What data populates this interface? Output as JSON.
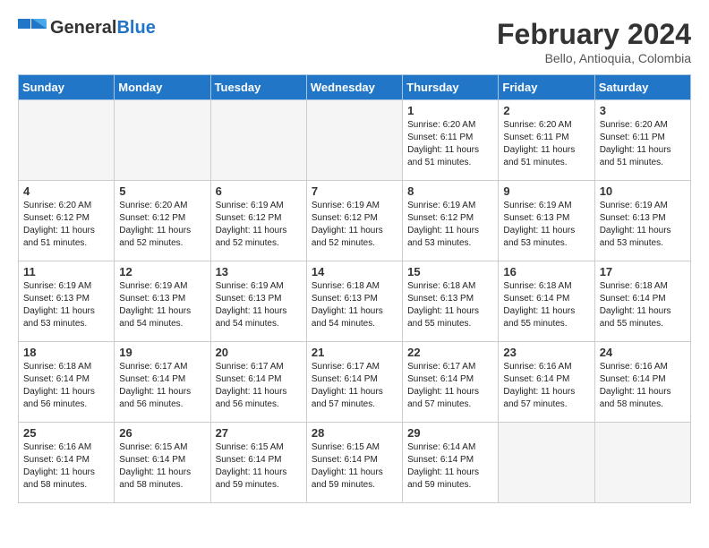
{
  "header": {
    "logo_general": "General",
    "logo_blue": "Blue",
    "month_title": "February 2024",
    "location": "Bello, Antioquia, Colombia"
  },
  "days_of_week": [
    "Sunday",
    "Monday",
    "Tuesday",
    "Wednesday",
    "Thursday",
    "Friday",
    "Saturday"
  ],
  "weeks": [
    [
      {
        "day": "",
        "info": ""
      },
      {
        "day": "",
        "info": ""
      },
      {
        "day": "",
        "info": ""
      },
      {
        "day": "",
        "info": ""
      },
      {
        "day": "1",
        "info": "Sunrise: 6:20 AM\nSunset: 6:11 PM\nDaylight: 11 hours\nand 51 minutes."
      },
      {
        "day": "2",
        "info": "Sunrise: 6:20 AM\nSunset: 6:11 PM\nDaylight: 11 hours\nand 51 minutes."
      },
      {
        "day": "3",
        "info": "Sunrise: 6:20 AM\nSunset: 6:11 PM\nDaylight: 11 hours\nand 51 minutes."
      }
    ],
    [
      {
        "day": "4",
        "info": "Sunrise: 6:20 AM\nSunset: 6:12 PM\nDaylight: 11 hours\nand 51 minutes."
      },
      {
        "day": "5",
        "info": "Sunrise: 6:20 AM\nSunset: 6:12 PM\nDaylight: 11 hours\nand 52 minutes."
      },
      {
        "day": "6",
        "info": "Sunrise: 6:19 AM\nSunset: 6:12 PM\nDaylight: 11 hours\nand 52 minutes."
      },
      {
        "day": "7",
        "info": "Sunrise: 6:19 AM\nSunset: 6:12 PM\nDaylight: 11 hours\nand 52 minutes."
      },
      {
        "day": "8",
        "info": "Sunrise: 6:19 AM\nSunset: 6:12 PM\nDaylight: 11 hours\nand 53 minutes."
      },
      {
        "day": "9",
        "info": "Sunrise: 6:19 AM\nSunset: 6:13 PM\nDaylight: 11 hours\nand 53 minutes."
      },
      {
        "day": "10",
        "info": "Sunrise: 6:19 AM\nSunset: 6:13 PM\nDaylight: 11 hours\nand 53 minutes."
      }
    ],
    [
      {
        "day": "11",
        "info": "Sunrise: 6:19 AM\nSunset: 6:13 PM\nDaylight: 11 hours\nand 53 minutes."
      },
      {
        "day": "12",
        "info": "Sunrise: 6:19 AM\nSunset: 6:13 PM\nDaylight: 11 hours\nand 54 minutes."
      },
      {
        "day": "13",
        "info": "Sunrise: 6:19 AM\nSunset: 6:13 PM\nDaylight: 11 hours\nand 54 minutes."
      },
      {
        "day": "14",
        "info": "Sunrise: 6:18 AM\nSunset: 6:13 PM\nDaylight: 11 hours\nand 54 minutes."
      },
      {
        "day": "15",
        "info": "Sunrise: 6:18 AM\nSunset: 6:13 PM\nDaylight: 11 hours\nand 55 minutes."
      },
      {
        "day": "16",
        "info": "Sunrise: 6:18 AM\nSunset: 6:14 PM\nDaylight: 11 hours\nand 55 minutes."
      },
      {
        "day": "17",
        "info": "Sunrise: 6:18 AM\nSunset: 6:14 PM\nDaylight: 11 hours\nand 55 minutes."
      }
    ],
    [
      {
        "day": "18",
        "info": "Sunrise: 6:18 AM\nSunset: 6:14 PM\nDaylight: 11 hours\nand 56 minutes."
      },
      {
        "day": "19",
        "info": "Sunrise: 6:17 AM\nSunset: 6:14 PM\nDaylight: 11 hours\nand 56 minutes."
      },
      {
        "day": "20",
        "info": "Sunrise: 6:17 AM\nSunset: 6:14 PM\nDaylight: 11 hours\nand 56 minutes."
      },
      {
        "day": "21",
        "info": "Sunrise: 6:17 AM\nSunset: 6:14 PM\nDaylight: 11 hours\nand 57 minutes."
      },
      {
        "day": "22",
        "info": "Sunrise: 6:17 AM\nSunset: 6:14 PM\nDaylight: 11 hours\nand 57 minutes."
      },
      {
        "day": "23",
        "info": "Sunrise: 6:16 AM\nSunset: 6:14 PM\nDaylight: 11 hours\nand 57 minutes."
      },
      {
        "day": "24",
        "info": "Sunrise: 6:16 AM\nSunset: 6:14 PM\nDaylight: 11 hours\nand 58 minutes."
      }
    ],
    [
      {
        "day": "25",
        "info": "Sunrise: 6:16 AM\nSunset: 6:14 PM\nDaylight: 11 hours\nand 58 minutes."
      },
      {
        "day": "26",
        "info": "Sunrise: 6:15 AM\nSunset: 6:14 PM\nDaylight: 11 hours\nand 58 minutes."
      },
      {
        "day": "27",
        "info": "Sunrise: 6:15 AM\nSunset: 6:14 PM\nDaylight: 11 hours\nand 59 minutes."
      },
      {
        "day": "28",
        "info": "Sunrise: 6:15 AM\nSunset: 6:14 PM\nDaylight: 11 hours\nand 59 minutes."
      },
      {
        "day": "29",
        "info": "Sunrise: 6:14 AM\nSunset: 6:14 PM\nDaylight: 11 hours\nand 59 minutes."
      },
      {
        "day": "",
        "info": ""
      },
      {
        "day": "",
        "info": ""
      }
    ]
  ]
}
